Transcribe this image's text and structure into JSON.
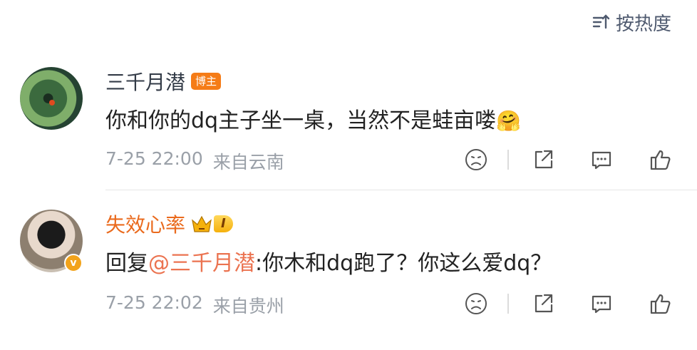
{
  "sort": {
    "label": "按热度"
  },
  "comments": [
    {
      "name": "三千月潜",
      "badge": "博主",
      "text": "你和你的dq主子坐一桌，当然不是蛙亩喽",
      "emoji": "🤗",
      "date": "7-25 22:00",
      "location": "来自云南"
    },
    {
      "name": "失效心率",
      "level": "I",
      "verified": "v",
      "reply_prefix": "回复",
      "mention": "@三千月潜",
      "text": ":你木和dq跑了？你这么爱dq？",
      "date": "7-25 22:02",
      "location": "来自贵州"
    }
  ],
  "colors": {
    "accent": "#eb7350",
    "vip_name": "#ea6a1d",
    "badge": "#f57c17",
    "meta": "#9aa0a8"
  }
}
